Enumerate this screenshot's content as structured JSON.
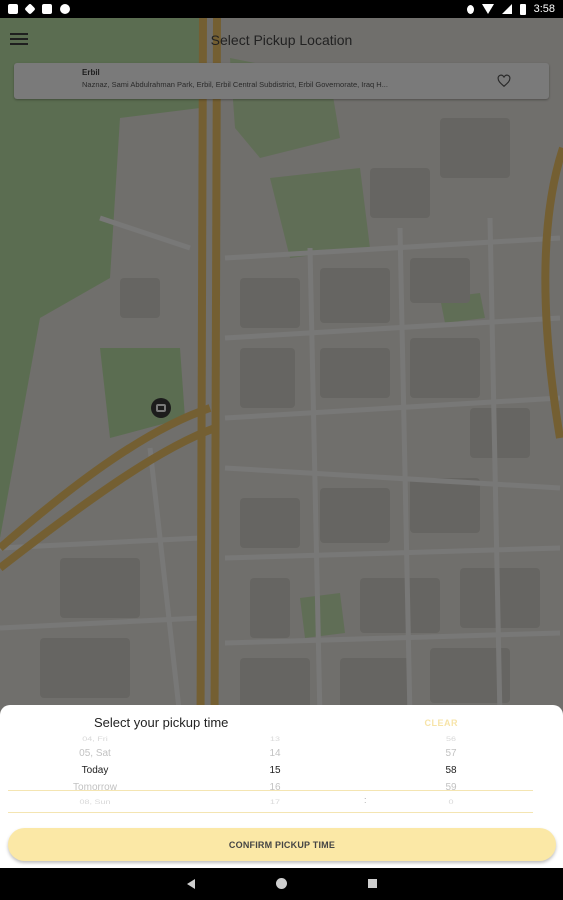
{
  "status_bar": {
    "time": "3:58",
    "left_icons": [
      "notification-icon",
      "settings-icon",
      "sd-card-icon",
      "vpn-icon"
    ],
    "right_icons": [
      "location-icon",
      "wifi-icon",
      "signal-icon",
      "battery-icon"
    ]
  },
  "app_bar": {
    "title": "Select Pickup Location",
    "menu_icon": "hamburger-menu-icon"
  },
  "address_card": {
    "city": "Erbil",
    "address": "Naznaz, Sami Abdulrahman Park, Erbil, Erbil Central Subdistrict, Erbil Governorate, Iraq H...",
    "favorite_icon": "heart-outline-icon"
  },
  "map": {
    "bus_stop_icon": "bus-stop-icon",
    "colors": {
      "park": "#bfe3a9",
      "road_major": "#f2c76a",
      "block": "#d6d3cc",
      "base": "#ebe8e2"
    }
  },
  "pickup_sheet": {
    "title": "Select your pickup time",
    "clear_label": "CLEAR",
    "day_options": [
      "04, Fri",
      "05, Sat",
      "Today",
      "Tomorrow",
      "08, Sun"
    ],
    "hour_options": [
      "13",
      "14",
      "15",
      "16",
      "17"
    ],
    "minute_options": [
      "56",
      "57",
      "58",
      "59",
      "0"
    ],
    "separator": ":",
    "confirm_label": "CONFIRM PICKUP TIME",
    "accent_color": "#fbe8a6"
  },
  "nav_bar": {
    "back_icon": "back-triangle-icon",
    "home_icon": "home-circle-icon",
    "recents_icon": "recents-square-icon"
  }
}
